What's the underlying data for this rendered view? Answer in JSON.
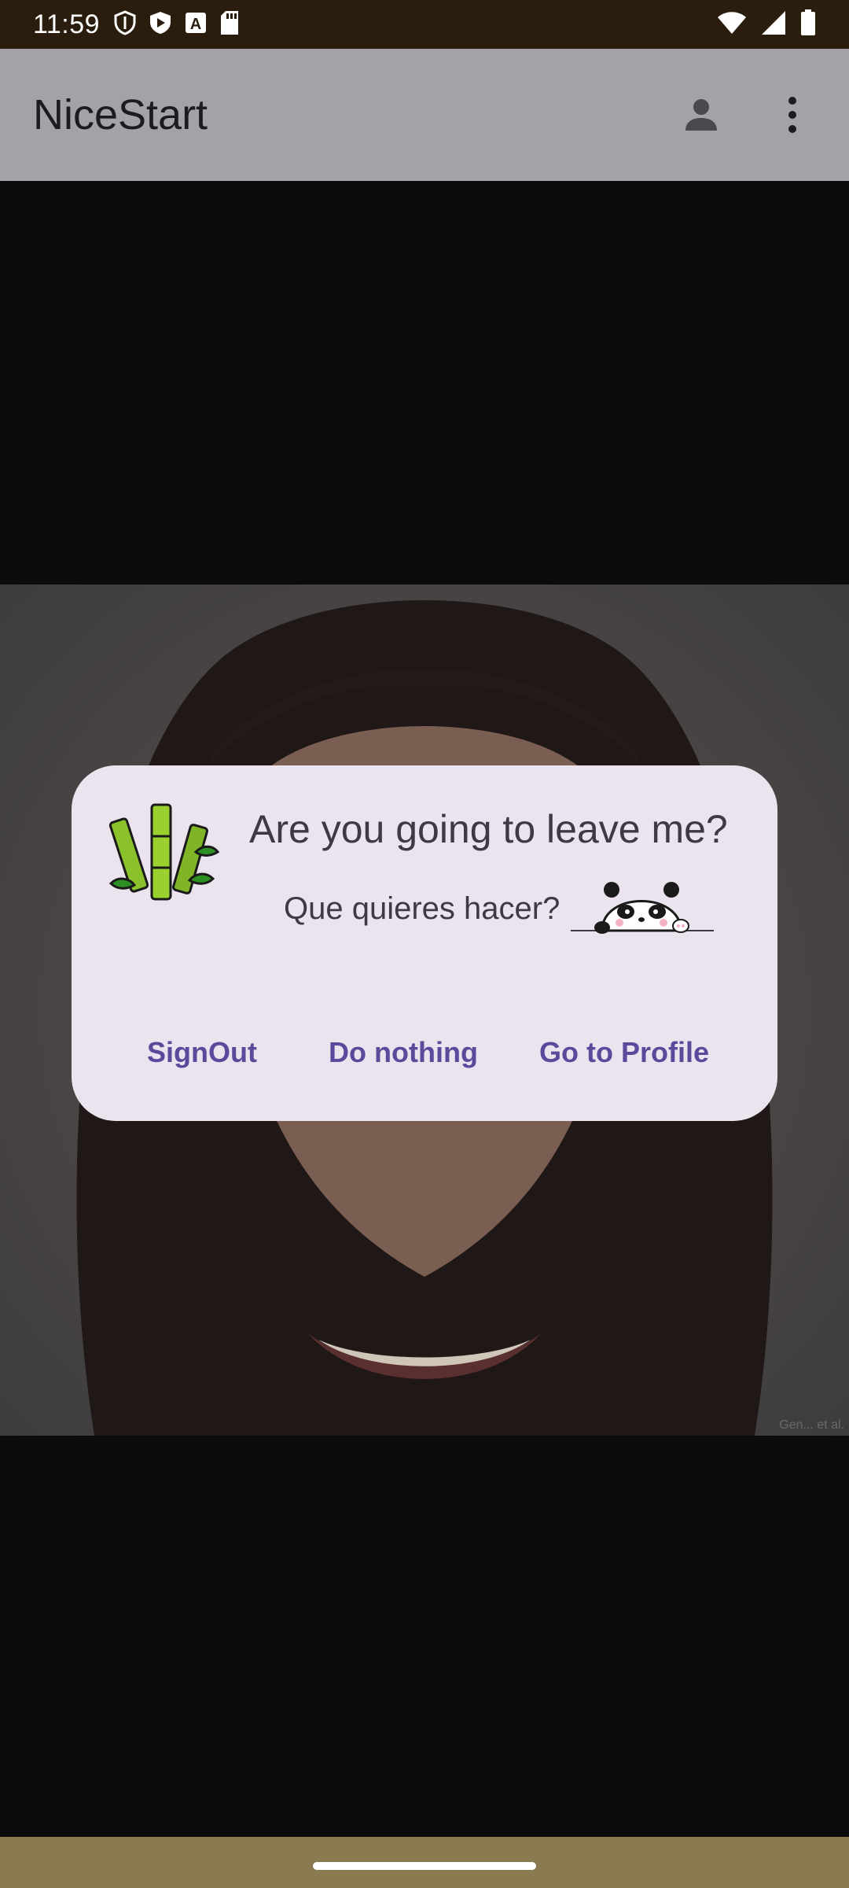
{
  "status_bar": {
    "time": "11:59",
    "left_icons": [
      "shield-icon",
      "play-protect-icon",
      "a-badge-icon",
      "sd-card-icon"
    ],
    "right_icons": [
      "wifi-icon",
      "signal-icon",
      "battery-icon"
    ]
  },
  "app_bar": {
    "title": "NiceStart",
    "actions": [
      "account-icon",
      "more-vert-icon"
    ]
  },
  "photo": {
    "credit": "Gen... et al."
  },
  "dialog": {
    "title": "Are you going to leave me?",
    "message": "Que quieres hacer?",
    "buttons": {
      "signout": "SignOut",
      "nothing": "Do nothing",
      "profile": "Go to Profile"
    },
    "accent_color": "#5b4a9b"
  },
  "colors": {
    "status_bar": "#2b1d0e",
    "app_bar": "#a4a2a8",
    "dialog_bg": "#ebe4ee",
    "nav_bar": "#8a7a50"
  }
}
